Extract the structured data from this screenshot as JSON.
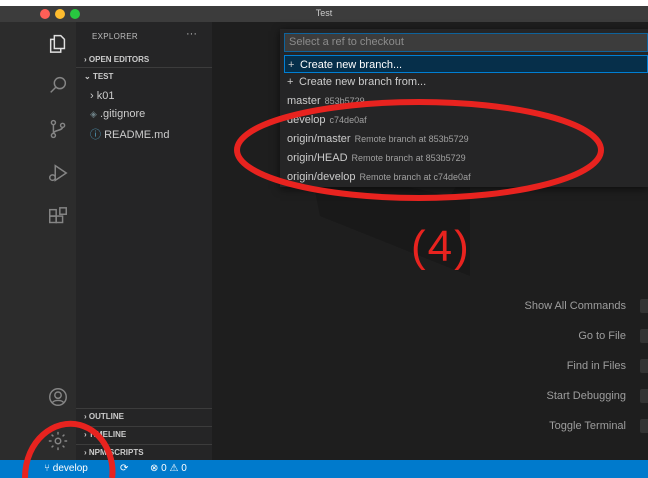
{
  "window": {
    "title": "Test"
  },
  "sidebar": {
    "header": "EXPLORER",
    "more": "···",
    "open_editors": "OPEN EDITORS",
    "project": "TEST",
    "files": [
      {
        "name": "k01",
        "prefix": "›"
      },
      {
        "name": ".gitignore",
        "prefix": "◈"
      },
      {
        "name": "README.md",
        "prefix": "ⓘ"
      }
    ],
    "outline": "OUTLINE",
    "timeline": "TIMELINE",
    "npm_scripts": "NPM SCRIPTS"
  },
  "quickpick": {
    "placeholder": "Select a ref to checkout",
    "items": [
      {
        "label": "Create new branch...",
        "desc": "",
        "plus": "+"
      },
      {
        "label": "Create new branch from...",
        "desc": "",
        "plus": "+"
      },
      {
        "label": "master",
        "desc": "853b5729"
      },
      {
        "label": "develop",
        "desc": "c74de0af"
      },
      {
        "label": "origin/master",
        "desc": "Remote branch at 853b5729"
      },
      {
        "label": "origin/HEAD",
        "desc": "Remote branch at 853b5729"
      },
      {
        "label": "origin/develop",
        "desc": "Remote branch at c74de0af"
      }
    ]
  },
  "editor": {
    "hints": [
      "Show All Commands",
      "Go to File",
      "Find in Files",
      "Start Debugging",
      "Toggle Terminal"
    ]
  },
  "statusbar": {
    "branch": "develop",
    "problems": "⊗ 0 ⚠ 0"
  },
  "annotation": {
    "label": "(4)",
    "color": "#e8231f"
  },
  "colors": {
    "accent": "#007acc",
    "selection": "#062f4a"
  }
}
